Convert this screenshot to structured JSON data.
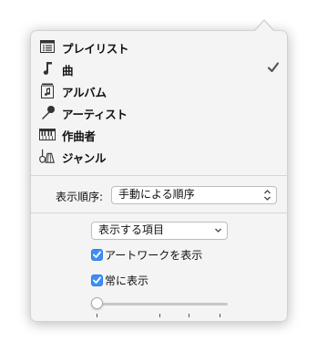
{
  "menu": {
    "items": [
      {
        "label": "プレイリスト",
        "icon": "playlist-icon",
        "checked": false
      },
      {
        "label": "曲",
        "icon": "music-note-icon",
        "checked": true
      },
      {
        "label": "アルバム",
        "icon": "album-icon",
        "checked": false
      },
      {
        "label": "アーティスト",
        "icon": "microphone-icon",
        "checked": false
      },
      {
        "label": "作曲者",
        "icon": "piano-icon",
        "checked": false
      },
      {
        "label": "ジャンル",
        "icon": "instruments-icon",
        "checked": false
      }
    ]
  },
  "sort": {
    "label": "表示順序:",
    "value": "手動による順序"
  },
  "view_options": {
    "select_value": "表示する項目",
    "artwork_label": "アートワークを表示",
    "artwork_checked": true,
    "always_label": "常に表示",
    "always_checked": true,
    "slider_ticks": 4
  },
  "colors": {
    "accent": "#3d8ef5",
    "popover_bg": "#f4f4f4"
  }
}
